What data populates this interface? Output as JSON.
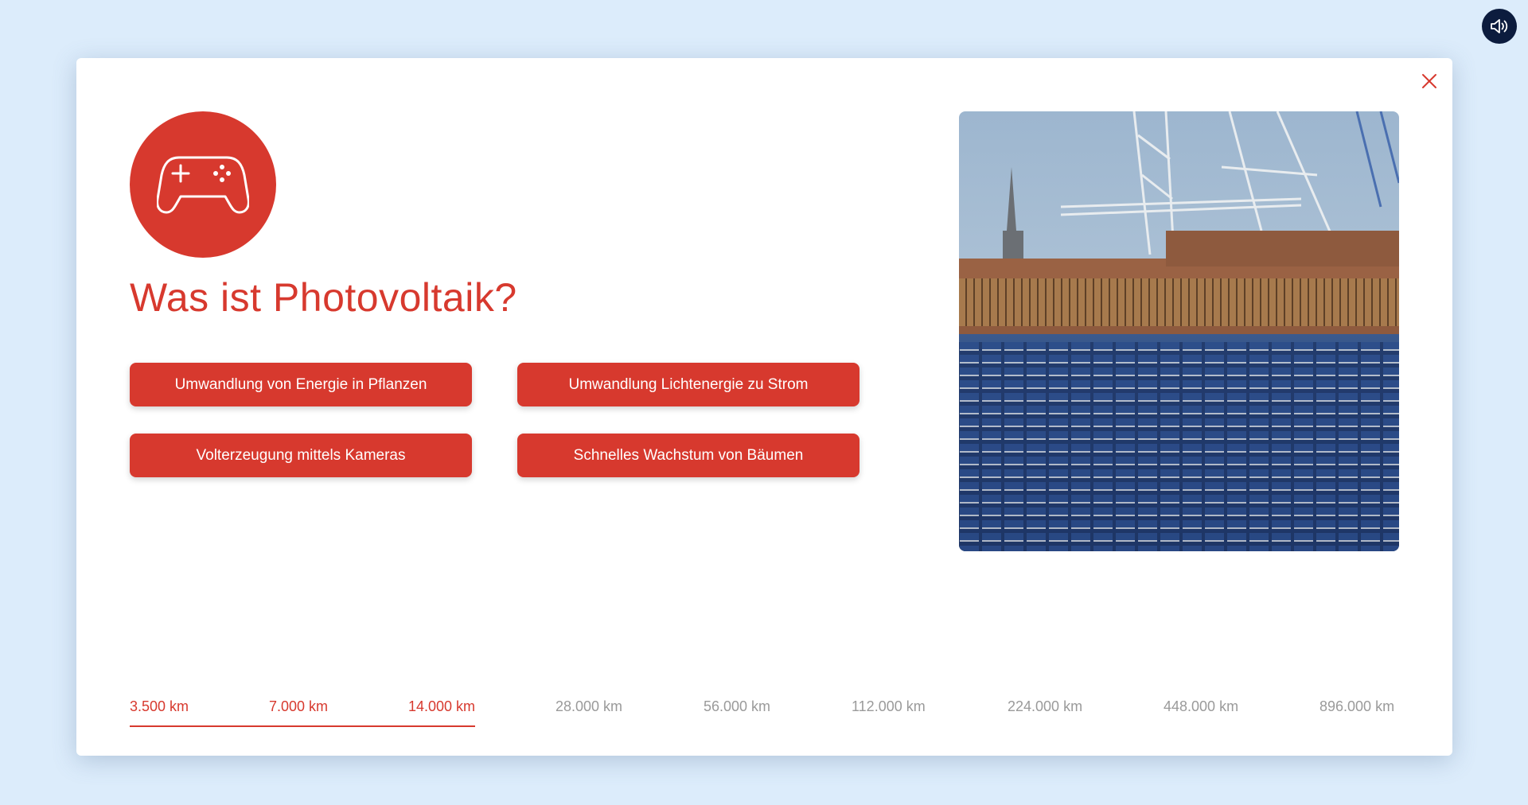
{
  "audio": {
    "icon": "speaker-icon"
  },
  "dialog": {
    "close_icon": "close-icon",
    "game_icon": "gamepad-icon",
    "question": "Was ist Photovoltaik?",
    "answers": [
      {
        "label": "Umwandlung von Energie in Pflanzen"
      },
      {
        "label": "Umwandlung Lichtenergie zu Strom"
      },
      {
        "label": "Volterzeugung mittels Kameras"
      },
      {
        "label": "Schnelles Wachstum von Bäumen"
      }
    ],
    "image": {
      "subject": "solar panels on a rooftop with harbor cranes and a church spire"
    }
  },
  "progress": {
    "steps": [
      {
        "label": "3.500 km",
        "completed": true
      },
      {
        "label": "7.000 km",
        "completed": true
      },
      {
        "label": "14.000 km",
        "completed": true
      },
      {
        "label": "28.000 km",
        "completed": false
      },
      {
        "label": "56.000 km",
        "completed": false
      },
      {
        "label": "112.000 km",
        "completed": false
      },
      {
        "label": "224.000 km",
        "completed": false
      },
      {
        "label": "448.000 km",
        "completed": false
      },
      {
        "label": "896.000 km",
        "completed": false
      }
    ],
    "completed_count": 3
  },
  "colors": {
    "accent": "#d7392e",
    "background": "#dcecfb",
    "sound_button": "#0c1c3e",
    "inactive_text": "#9a9a9a"
  }
}
